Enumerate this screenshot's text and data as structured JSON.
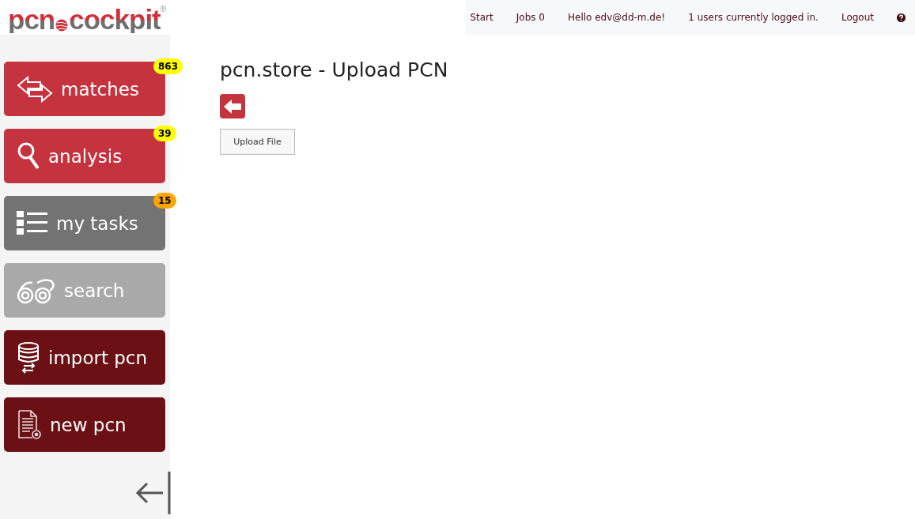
{
  "logo": {
    "left": "pcn",
    "right": "cockpit",
    "mark": "®"
  },
  "nav": [
    {
      "label": "Start"
    },
    {
      "label": "Jobs 0"
    },
    {
      "label": "Hello edv@dd-m.de!"
    },
    {
      "label": "1 users currently logged in."
    },
    {
      "label": "Logout"
    }
  ],
  "sidebar": {
    "items": [
      {
        "kind": "arrows",
        "label": "matches",
        "color": "#c5333f",
        "badge": {
          "text": "863",
          "color": "#ffff00"
        }
      },
      {
        "kind": "magnifier",
        "label": "analysis",
        "color": "#c5333f",
        "badge": {
          "text": "39",
          "color": "#ffff00"
        }
      },
      {
        "kind": "list",
        "label": "my tasks",
        "color": "#737373",
        "badge": {
          "text": "15",
          "color": "#ffa500"
        }
      },
      {
        "kind": "binoculars",
        "label": "search",
        "color": "#a9a9a9"
      },
      {
        "kind": "database",
        "label": "import pcn",
        "color": "#6b1116"
      },
      {
        "kind": "document",
        "label": "new pcn",
        "color": "#6b1116"
      }
    ]
  },
  "page": {
    "title": "pcn.store - Upload PCN",
    "upload_button": "Upload File"
  }
}
